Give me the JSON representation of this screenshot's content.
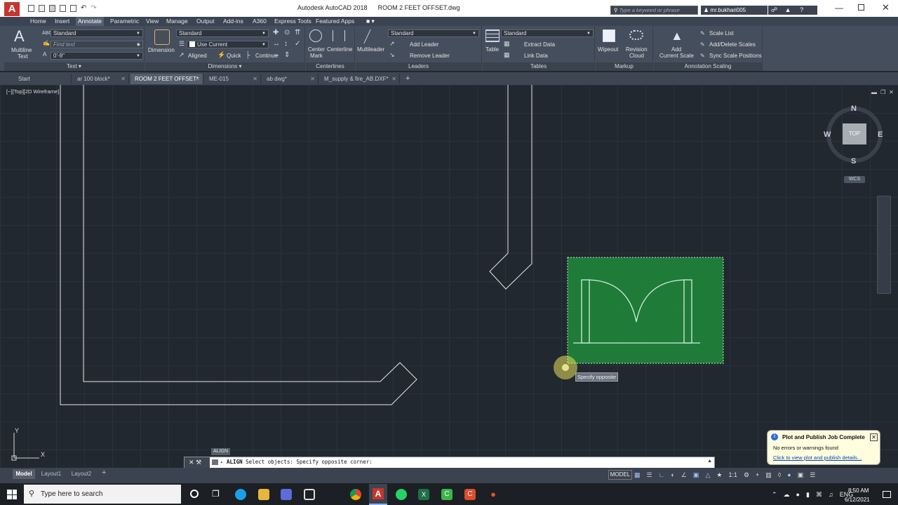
{
  "title": {
    "app": "Autodesk AutoCAD 2018",
    "document": "ROOM 2 FEET OFFSET.dwg",
    "search_placeholder": "Type a keyword or phrase",
    "user": "mr.bukhari005"
  },
  "ribbon_tabs": [
    "Home",
    "Insert",
    "Annotate",
    "Parametric",
    "View",
    "Manage",
    "Output",
    "Add-ins",
    "A360",
    "Express Tools",
    "Featured Apps"
  ],
  "ribbon": {
    "text": {
      "big_label_1": "Multiline",
      "big_label_2": "Text",
      "style": "Standard",
      "find_placeholder": "Find text",
      "height": "0'-9\"",
      "title": "Text"
    },
    "dimensions": {
      "big_label": "Dimension",
      "style": "Standard",
      "layer": "Use Current",
      "aligned": "Aligned",
      "quick": "Quick",
      "continue": "Continue",
      "title": "Dimensions"
    },
    "centerlines": {
      "center_1": "Center",
      "center_2": "Mark",
      "centerline": "Centerline",
      "title": "Centerlines"
    },
    "leaders": {
      "big_label": "Multileader",
      "style": "Standard",
      "add": "Add Leader",
      "remove": "Remove Leader",
      "title": "Leaders"
    },
    "tables": {
      "big_label": "Table",
      "style": "Standard",
      "extract": "Extract Data",
      "link": "Link Data",
      "title": "Tables"
    },
    "markup": {
      "wipeout": "Wipeout",
      "revision_1": "Revision",
      "revision_2": "Cloud",
      "title": "Markup"
    },
    "scaling": {
      "add_1": "Add",
      "add_2": "Current Scale",
      "scale_list": "Scale List",
      "add_delete": "Add/Delete Scales",
      "sync": "Sync Scale Positions",
      "title": "Annotation Scaling"
    }
  },
  "doc_tabs": [
    "Start",
    "ar 100 block*",
    "ROOM 2 FEET OFFSET*",
    "ME-015",
    "ab dwg*",
    "M_supply & fire_AB.DXF*"
  ],
  "viewport_label": "[−][Top][2D Wireframe]",
  "viewcube": {
    "n": "N",
    "s": "S",
    "e": "E",
    "w": "W",
    "top": "TOP",
    "wcs": "WCS"
  },
  "ucs": {
    "x": "X",
    "y": "Y"
  },
  "tooltip": "Specify opposite",
  "command": {
    "badge": "ALIGN",
    "line": "ALIGN Select objects: Specify opposite corner:",
    "keyword": "ALIGN",
    "rest": " Select objects: Specify opposite corner:"
  },
  "layout_tabs": [
    "Model",
    "Layout1",
    "Layout2"
  ],
  "status": {
    "model": "MODEL",
    "scale": "1:1"
  },
  "notification": {
    "title": "Plot and Publish Job Complete",
    "body": "No errors or warnings found",
    "link": "Click to view plot and publish details..."
  },
  "taskbar": {
    "search": "Type here to search",
    "lang": "ENG",
    "time": "8:50 AM",
    "date": "6/12/2021"
  },
  "colors": {
    "canvas": "#212830",
    "selection": "#1f8a3a",
    "ribbon": "#454e5c",
    "accent": "#c6362e"
  }
}
